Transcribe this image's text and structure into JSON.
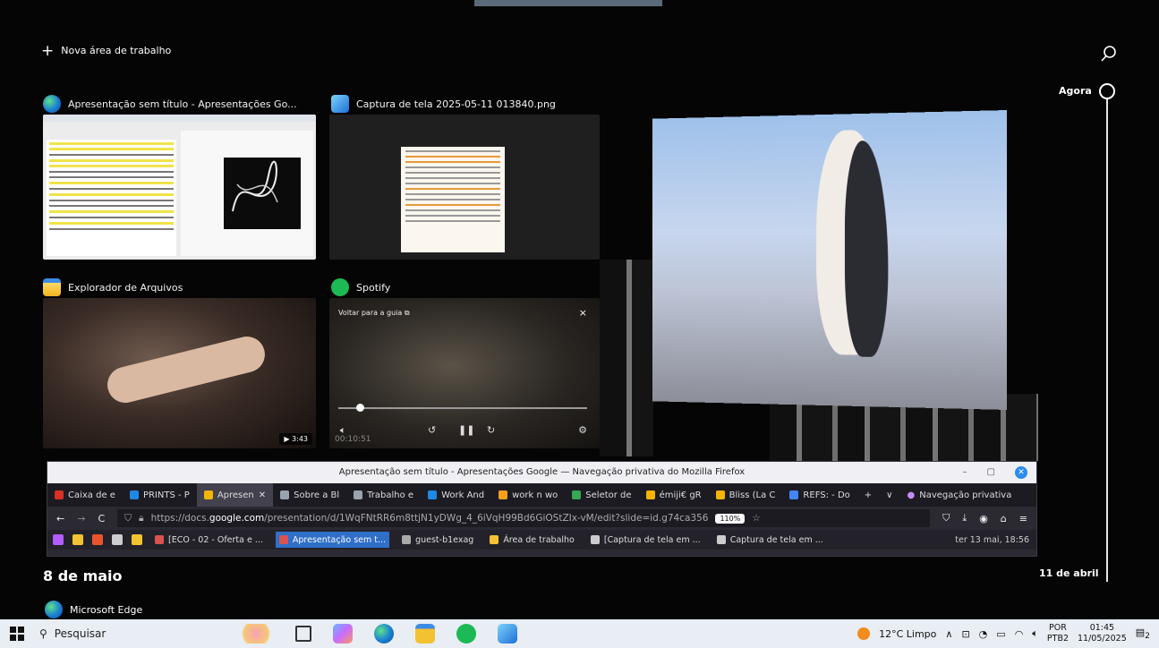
{
  "new_desktop": {
    "label": "Nova área de trabalho"
  },
  "timeline": {
    "now_label": "Agora",
    "april_label": "11 de abril"
  },
  "windows": [
    {
      "title": "Apresentação sem título - Apresentações Go...",
      "icon": "edge-icon",
      "color": "#1fa2d6"
    },
    {
      "title": "Captura de tela 2025-05-11 013840.png",
      "icon": "photos-icon",
      "color": "#2b7fd9"
    },
    {
      "title": "Explorador de Arquivos",
      "icon": "folder-icon",
      "color": "#f3c232"
    },
    {
      "title": "Spotify",
      "icon": "spotify-icon",
      "color": "#1db954"
    }
  ],
  "video_badge": "3:43",
  "pip": {
    "back_label": "Voltar para a guia",
    "close": "×",
    "time": "00:10:51"
  },
  "firefox": {
    "window_title": "Apresentação sem título - Apresentações Google — Navegação privativa do Mozilla Firefox",
    "tabs": [
      {
        "label": "Caixa de e",
        "color": "#d93025"
      },
      {
        "label": "PRINTS - P",
        "color": "#1e88e5"
      },
      {
        "label": "Apresen",
        "color": "#f4b400",
        "active": true
      },
      {
        "label": "Sobre a Bl",
        "color": "#9aa3ad"
      },
      {
        "label": "Trabalho e",
        "color": "#9aa3ad"
      },
      {
        "label": "Work And",
        "color": "#1e88e5"
      },
      {
        "label": "work n wo",
        "color": "#ff9f1c"
      },
      {
        "label": "Seletor de",
        "color": "#34a853"
      },
      {
        "label": "émiji€ gR",
        "color": "#f4b400"
      },
      {
        "label": "Bliss (La C",
        "color": "#f4b400"
      },
      {
        "label": "REFS: - Do",
        "color": "#4285f4"
      }
    ],
    "private_label": "Navegação privativa",
    "url_prefix": "https://docs.",
    "url_domain": "google.com",
    "url_rest": "/presentation/d/1WqFNtRR6m8ttjN1yDWg_4_6iVqH99Bd6GiOStZIx-vM/edit?slide=id.g74ca356",
    "zoom": "110%"
  },
  "bookmarks": [
    {
      "label": "[ECO - 02 - Oferta e ...",
      "color": "#d9534f"
    },
    {
      "label": "Apresentação sem t...",
      "color": "#d9534f",
      "active": true
    },
    {
      "label": "guest-b1exag",
      "color": "#aaaaaa"
    },
    {
      "label": "Área de trabalho",
      "color": "#f3c232"
    },
    {
      "label": "[Captura de tela em ...",
      "color": "#cccccc"
    },
    {
      "label": "Captura de tela em ...",
      "color": "#cccccc"
    }
  ],
  "bookmarks_status": "ter 13 mai, 18:56",
  "section": {
    "date": "8 de maio",
    "app": "Microsoft Edge"
  },
  "taskbar": {
    "search_placeholder": "Pesquisar",
    "weather": "12°C  Limpo",
    "lang_top": "POR",
    "lang_bottom": "PTB2",
    "time": "01:45",
    "date": "11/05/2025",
    "notifications": "2"
  }
}
